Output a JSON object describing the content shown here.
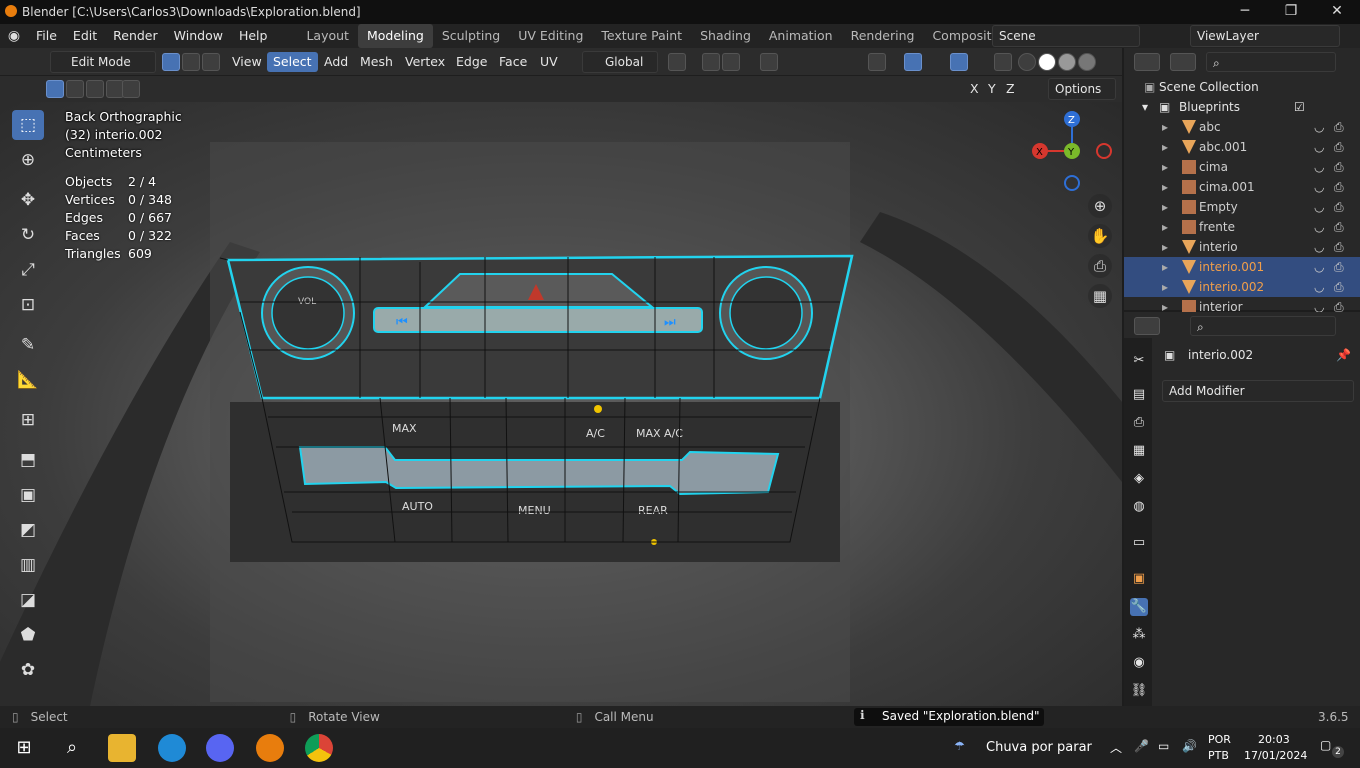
{
  "window": {
    "title": "Blender [C:\\Users\\Carlos3\\Downloads\\Exploration.blend]",
    "min": "─",
    "max": "❐",
    "close": "✕"
  },
  "menus": [
    "File",
    "Edit",
    "Render",
    "Window",
    "Help"
  ],
  "workspaces": [
    "Layout",
    "Modeling",
    "Sculpting",
    "UV Editing",
    "Texture Paint",
    "Shading",
    "Animation",
    "Rendering",
    "Compositing"
  ],
  "active_workspace": "Modeling",
  "scene": "Scene",
  "view_layer": "ViewLayer",
  "header": {
    "mode": "Edit Mode",
    "view": "View",
    "select": "Select",
    "add": "Add",
    "mesh": "Mesh",
    "vertex": "Vertex",
    "edge": "Edge",
    "face": "Face",
    "uv": "UV",
    "orientation": "Global",
    "options": "Options",
    "axes": [
      "X",
      "Y",
      "Z"
    ]
  },
  "overlay": {
    "view_name": "Back Orthographic",
    "object": "(32) interio.002",
    "units": "Centimeters"
  },
  "stats": [
    {
      "label": "Objects",
      "value": "2 / 4"
    },
    {
      "label": "Vertices",
      "value": "0 / 348"
    },
    {
      "label": "Edges",
      "value": "0 / 667"
    },
    {
      "label": "Faces",
      "value": "0 / 322"
    },
    {
      "label": "Triangles",
      "value": "609"
    }
  ],
  "gizmo": {
    "z": "Z",
    "y": "Y",
    "x": "X"
  },
  "outliner": {
    "root": "Scene Collection",
    "collection": "Blueprints",
    "items": [
      {
        "name": "abc",
        "kind": "mesh",
        "orange": false
      },
      {
        "name": "abc.001",
        "kind": "mesh",
        "orange": false
      },
      {
        "name": "cima",
        "kind": "image",
        "orange": false
      },
      {
        "name": "cima.001",
        "kind": "image",
        "orange": false
      },
      {
        "name": "Empty",
        "kind": "image",
        "orange": false
      },
      {
        "name": "frente",
        "kind": "image",
        "orange": false
      },
      {
        "name": "interio",
        "kind": "mesh",
        "orange": false
      },
      {
        "name": "interio.001",
        "kind": "mesh",
        "orange": true
      },
      {
        "name": "interio.002",
        "kind": "mesh",
        "orange": true
      },
      {
        "name": "interior",
        "kind": "image",
        "orange": false
      }
    ]
  },
  "properties": {
    "object": "interio.002",
    "add_modifier": "Add Modifier"
  },
  "status": {
    "select": "Select",
    "rotate": "Rotate View",
    "menu": "Call Menu",
    "saved": "Saved \"Exploration.blend\"",
    "version": "3.6.5"
  },
  "taskbar": {
    "weather": "Chuva por parar",
    "lang1": "POR",
    "lang2": "PTB",
    "time": "20:03",
    "date": "17/01/2024",
    "notif": "2"
  },
  "panel_labels": {
    "vol": "VOL",
    "buttons": [
      "MAX",
      "A/C",
      "MAX A/C",
      "AUTO",
      "MENU",
      "REAR"
    ]
  },
  "colors": {
    "accent": "#4772b3",
    "mesh_edge": "#22d3ee",
    "blender_orange": "#e87d0d"
  }
}
